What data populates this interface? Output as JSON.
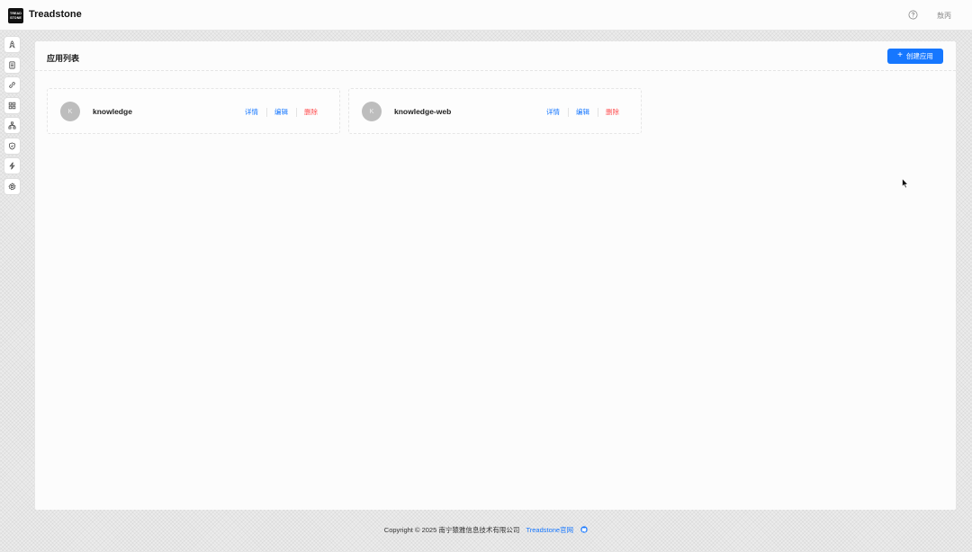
{
  "header": {
    "logo_line1": "TREAD",
    "logo_line2": "STONE",
    "brand": "Treadstone",
    "help_icon": "question-circle-icon",
    "user": "敖丙"
  },
  "sidebar": {
    "items": [
      {
        "icon": "rocket-icon"
      },
      {
        "icon": "document-icon"
      },
      {
        "icon": "link-icon"
      },
      {
        "icon": "apps-grid-icon"
      },
      {
        "icon": "cluster-icon"
      },
      {
        "icon": "shield-icon"
      },
      {
        "icon": "lightning-icon"
      },
      {
        "icon": "gear-icon"
      }
    ]
  },
  "panel": {
    "title": "应用列表",
    "create_button": "创建应用"
  },
  "apps": [
    {
      "initial": "K",
      "name": "knowledge",
      "detail": "详情",
      "edit": "编辑",
      "delete": "删除"
    },
    {
      "initial": "K",
      "name": "knowledge-web",
      "detail": "详情",
      "edit": "编辑",
      "delete": "删除"
    }
  ],
  "footer": {
    "copyright": "Copyright © 2025 南宁猿雅信息技术有限公司",
    "site_link": "Treadstone官网",
    "github_icon": "github-icon"
  },
  "colors": {
    "primary": "#1677ff",
    "danger": "#ff4d4f",
    "avatar": "#bdbdbd"
  }
}
